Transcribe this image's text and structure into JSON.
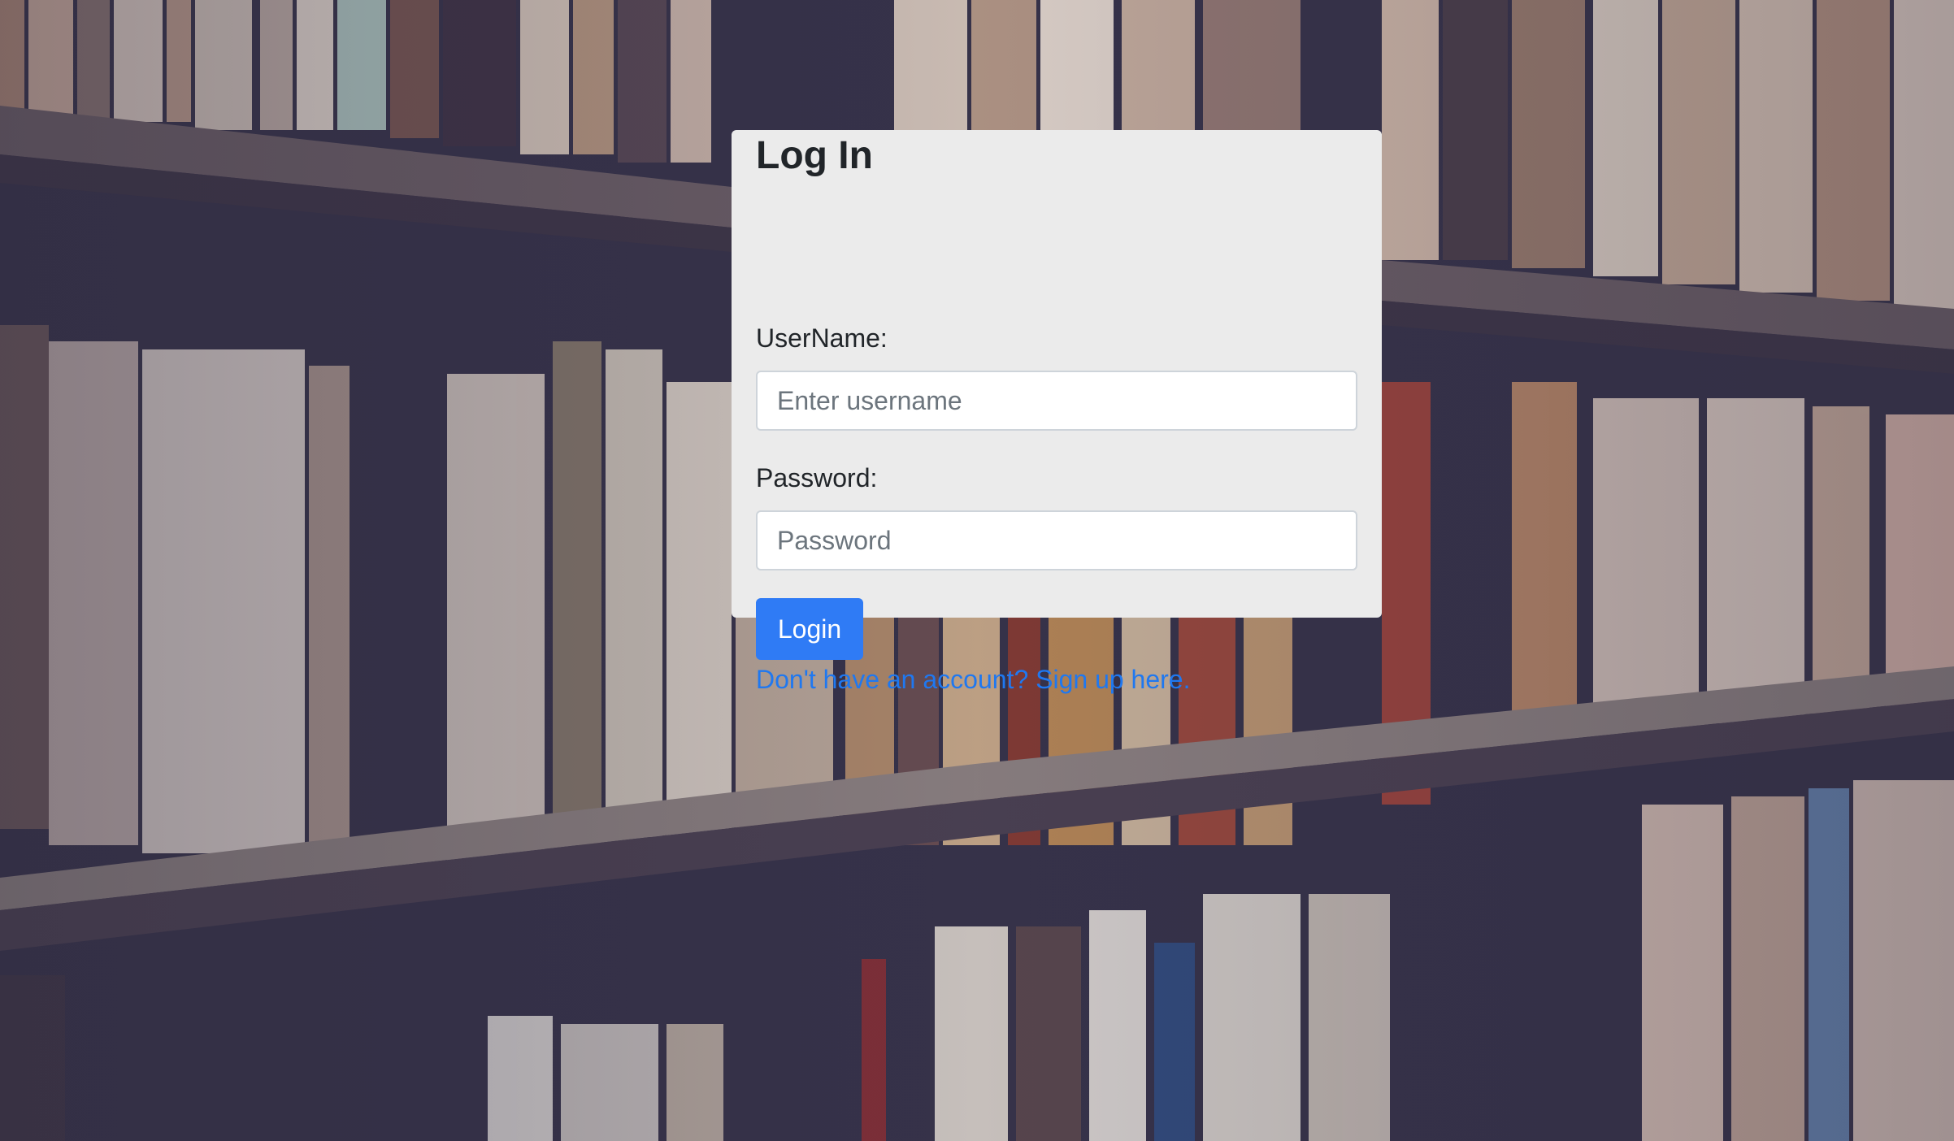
{
  "login_card": {
    "title": "Log In",
    "username_label": "UserName:",
    "username_placeholder": "Enter username",
    "password_label": "Password:",
    "password_placeholder": "Password",
    "login_button_label": "Login",
    "signup_link_text": "Don't have an account? Sign up here."
  },
  "colors": {
    "card_background": "#ebebeb",
    "button_primary": "#2f7bf5",
    "link": "#1f78f0"
  },
  "background": {
    "description_icon": "bookshelf-photo"
  }
}
